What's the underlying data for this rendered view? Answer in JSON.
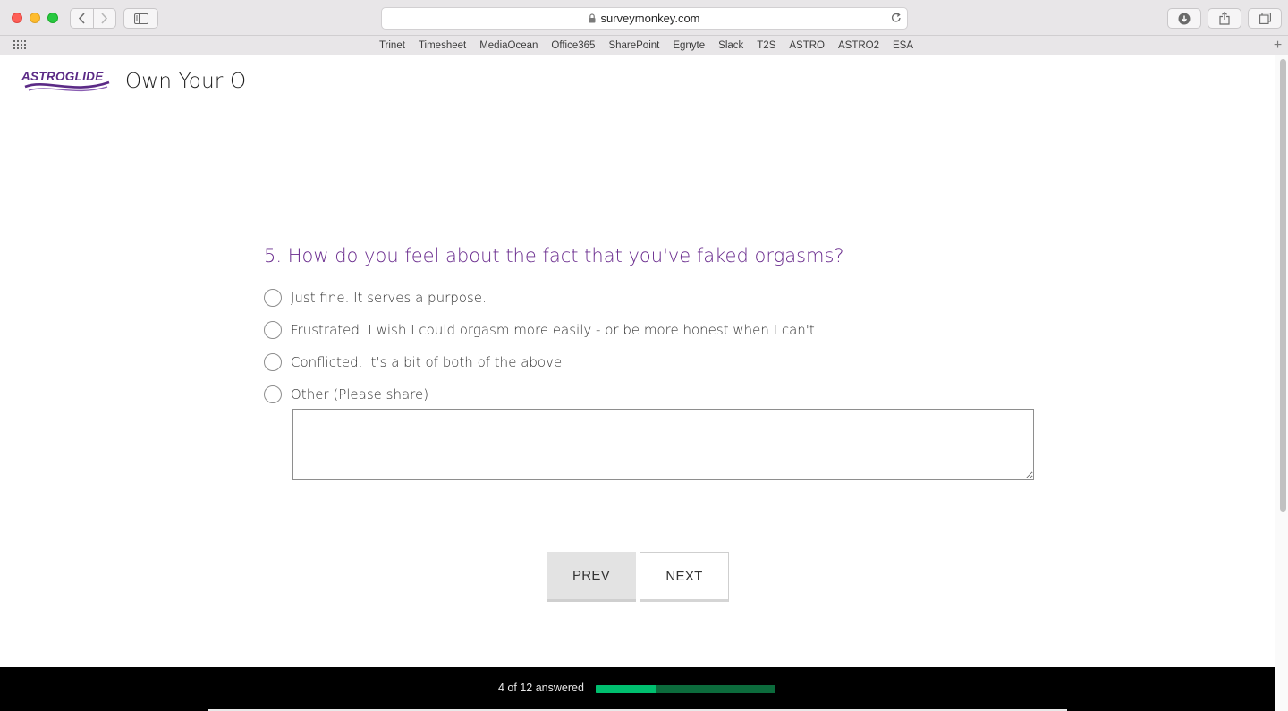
{
  "browser": {
    "url": "surveymonkey.com",
    "bookmarks": [
      "Trinet",
      "Timesheet",
      "MediaOcean",
      "Office365",
      "SharePoint",
      "Egnyte",
      "Slack",
      "T2S",
      "ASTRO",
      "ASTRO2",
      "ESA"
    ]
  },
  "header": {
    "logo_text": "ASTROGLIDE",
    "title": "Own Your O"
  },
  "question": {
    "text": "5. How do you feel about the fact that you've faked orgasms?",
    "choices": [
      "Just fine. It serves a purpose.",
      "Frustrated. I wish I could orgasm more easily - or be more honest when I can't.",
      "Conflicted. It's a bit of both of the above.",
      "Other (Please share)"
    ],
    "other_value": ""
  },
  "nav": {
    "prev_label": "PREV",
    "next_label": "NEXT"
  },
  "progress": {
    "text": "4 of 12 answered",
    "answered": 4,
    "total": 12
  },
  "colors": {
    "question": "#6a2c8e",
    "logo": "#5b2a86",
    "progress_fill": "#00bf6f",
    "progress_track": "#0c6b3c"
  }
}
